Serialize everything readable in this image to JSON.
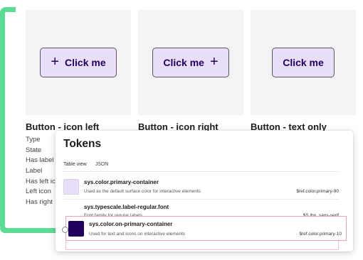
{
  "cards": [
    {
      "button_label": "Click me",
      "title": "Button - icon left",
      "icon": "plus-icon"
    },
    {
      "button_label": "Click me",
      "title": "Button - icon right",
      "icon": "plus-icon"
    },
    {
      "button_label": "Click me",
      "title": "Button - text only"
    }
  ],
  "plus_glyph": "+",
  "properties": [
    "Type",
    "State",
    "Has label",
    "Label",
    "Has left ic",
    "Left icon",
    "Has right"
  ],
  "tokens_panel": {
    "title": "Tokens",
    "tabs": [
      "Table view",
      "JSON"
    ],
    "active_tab": "Table view",
    "rows": [
      {
        "name": "sys.color.primary-container",
        "description": "Used as the default surface color for interactive elements",
        "ref": "$ref.color.primary-90",
        "swatch_color": "#e8def8"
      },
      {
        "name": "sys.typescale.label-regular.font",
        "description": "Font family for regular labels",
        "ref": "$S.lbp..sans-serif"
      },
      {
        "name": "sys.color.on-primary-container",
        "description": "Used for text and icons on interactive elements",
        "ref": "$ref.color.primary-10",
        "swatch_color": "#21005d"
      }
    ]
  },
  "colors": {
    "accent_green": "#5cdb95",
    "button_fill": "#e8def8",
    "button_text": "#21005d",
    "highlight_border": "#f2a1b0"
  }
}
